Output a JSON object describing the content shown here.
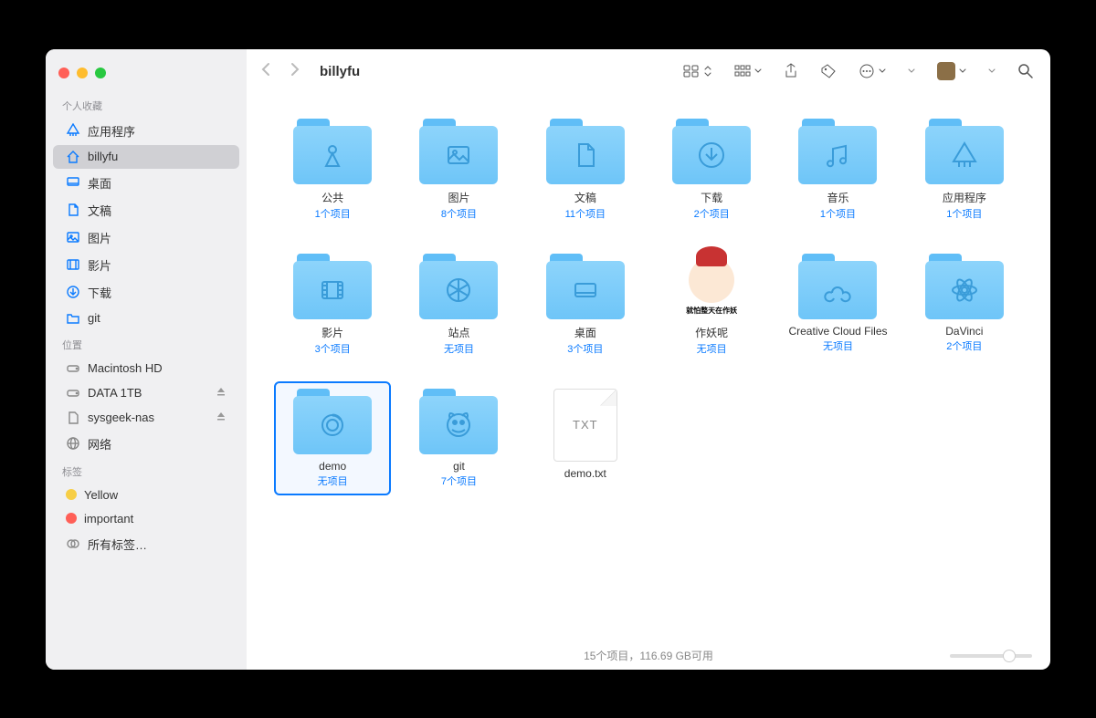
{
  "title": "billyfu",
  "sidebar": {
    "favorites_label": "个人收藏",
    "favorites": [
      {
        "label": "应用程序",
        "icon": "apps"
      },
      {
        "label": "billyfu",
        "icon": "home",
        "active": true
      },
      {
        "label": "桌面",
        "icon": "desktop"
      },
      {
        "label": "文稿",
        "icon": "document"
      },
      {
        "label": "图片",
        "icon": "pictures"
      },
      {
        "label": "影片",
        "icon": "movies"
      },
      {
        "label": "下载",
        "icon": "downloads"
      },
      {
        "label": "git",
        "icon": "folder"
      }
    ],
    "locations_label": "位置",
    "locations": [
      {
        "label": "Macintosh HD",
        "icon": "disk"
      },
      {
        "label": "DATA 1TB",
        "icon": "disk",
        "eject": true
      },
      {
        "label": "sysgeek-nas",
        "icon": "server",
        "eject": true
      },
      {
        "label": "网络",
        "icon": "network"
      }
    ],
    "tags_label": "标签",
    "tags": [
      {
        "label": "Yellow",
        "color": "#f7ce46"
      },
      {
        "label": "important",
        "color": "#ff5f57"
      },
      {
        "label": "所有标签…",
        "icon": "alltags"
      }
    ]
  },
  "items": [
    {
      "name": "公共",
      "sub": "1个项目",
      "type": "folder",
      "glyph": "public"
    },
    {
      "name": "图片",
      "sub": "8个项目",
      "type": "folder",
      "glyph": "pictures"
    },
    {
      "name": "文稿",
      "sub": "11个项目",
      "type": "folder",
      "glyph": "document"
    },
    {
      "name": "下载",
      "sub": "2个项目",
      "type": "folder",
      "glyph": "downloads"
    },
    {
      "name": "音乐",
      "sub": "1个项目",
      "type": "folder",
      "glyph": "music"
    },
    {
      "name": "应用程序",
      "sub": "1个项目",
      "type": "folder",
      "glyph": "apps"
    },
    {
      "name": "影片",
      "sub": "3个项目",
      "type": "folder",
      "glyph": "movies"
    },
    {
      "name": "站点",
      "sub": "无项目",
      "type": "folder",
      "glyph": "sites"
    },
    {
      "name": "桌面",
      "sub": "3个项目",
      "type": "folder",
      "glyph": "desktop"
    },
    {
      "name": "作妖呢",
      "sub": "无项目",
      "type": "custom",
      "caption": "就怕整天在作妖"
    },
    {
      "name": "Creative Cloud Files",
      "sub": "无项目",
      "type": "folder",
      "glyph": "cc"
    },
    {
      "name": "DaVinci",
      "sub": "2个项目",
      "type": "folder",
      "glyph": "davinci"
    },
    {
      "name": "demo",
      "sub": "无项目",
      "type": "folder",
      "glyph": "demo",
      "selected": true
    },
    {
      "name": "git",
      "sub": "7个项目",
      "type": "folder",
      "glyph": "git"
    },
    {
      "name": "demo.txt",
      "sub": "",
      "type": "file",
      "ext": "TXT"
    }
  ],
  "status": "15个项目，116.69 GB可用"
}
